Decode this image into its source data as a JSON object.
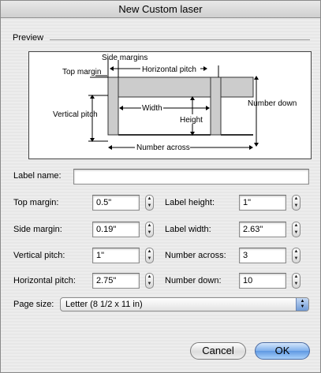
{
  "window": {
    "title": "New Custom laser"
  },
  "preview": {
    "section_label": "Preview",
    "diagram": {
      "side_margins": "Side margins",
      "top_margin": "Top margin",
      "horizontal_pitch": "Horizontal pitch",
      "number_down": "Number down",
      "vertical_pitch": "Vertical pitch",
      "width": "Width",
      "height": "Height",
      "number_across": "Number across"
    }
  },
  "form": {
    "label_name": {
      "label": "Label name:",
      "value": ""
    },
    "top_margin": {
      "label": "Top margin:",
      "value": "0.5\""
    },
    "side_margin": {
      "label": "Side margin:",
      "value": "0.19\""
    },
    "vertical_pitch": {
      "label": "Vertical pitch:",
      "value": "1\""
    },
    "horizontal_pitch": {
      "label": "Horizontal pitch:",
      "value": "2.75\""
    },
    "label_height": {
      "label": "Label height:",
      "value": "1\""
    },
    "label_width": {
      "label": "Label width:",
      "value": "2.63\""
    },
    "number_across": {
      "label": "Number across:",
      "value": "3"
    },
    "number_down": {
      "label": "Number down:",
      "value": "10"
    },
    "page_size": {
      "label": "Page size:",
      "value": "Letter (8 1/2 x 11 in)"
    }
  },
  "buttons": {
    "cancel": "Cancel",
    "ok": "OK"
  },
  "colors": {
    "accent": "#6f9ad6",
    "label_fill": "#cccccc"
  }
}
